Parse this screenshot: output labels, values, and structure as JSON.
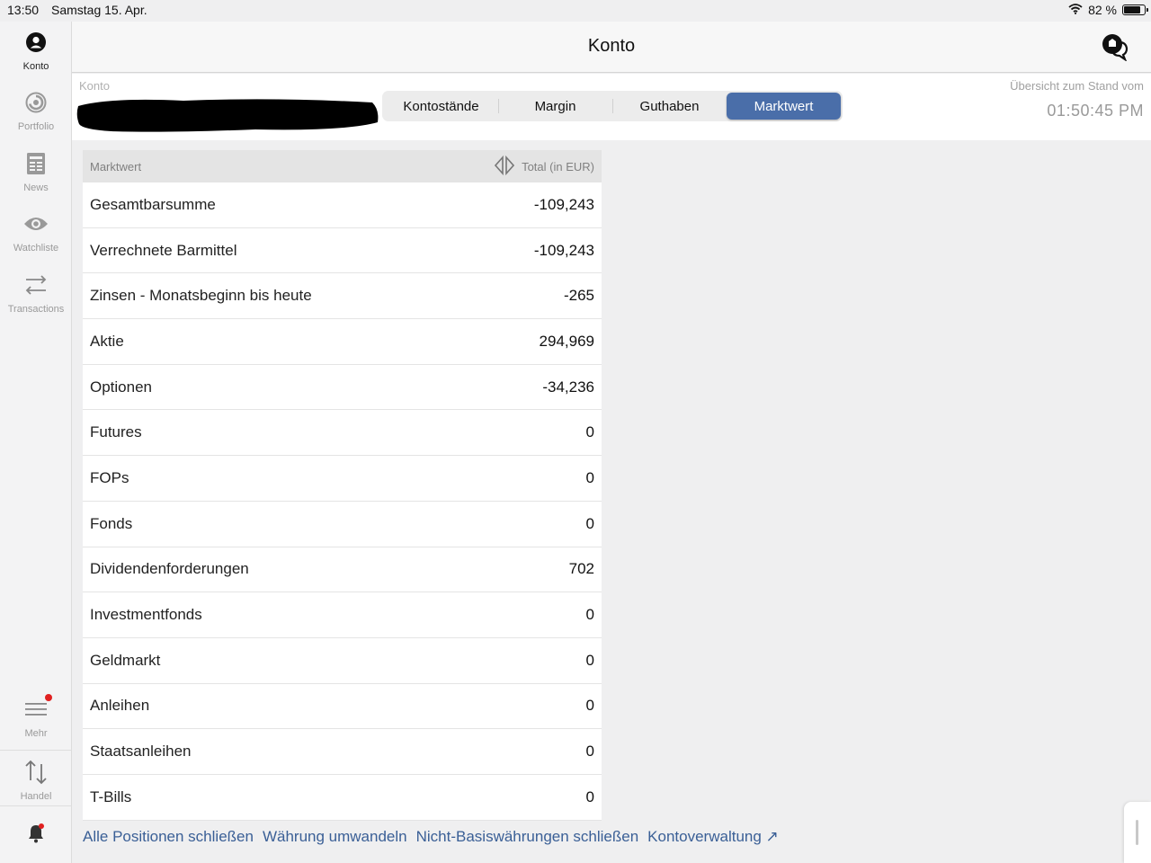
{
  "status_bar": {
    "time": "13:50",
    "date": "Samstag 15. Apr.",
    "battery": "82 %",
    "battery_level": 0.82
  },
  "sidebar": {
    "items": [
      {
        "label": "Konto",
        "icon": "account-icon",
        "active": true
      },
      {
        "label": "Portfolio",
        "icon": "portfolio-icon",
        "active": false
      },
      {
        "label": "News",
        "icon": "news-icon",
        "active": false
      },
      {
        "label": "Watchliste",
        "icon": "eye-icon",
        "active": false
      },
      {
        "label": "Transactions",
        "icon": "transactions-icon",
        "active": false
      }
    ],
    "more_label": "Mehr",
    "trade_label": "Handel"
  },
  "header": {
    "title": "Konto"
  },
  "account_bar": {
    "account_label": "Konto",
    "tabs": [
      {
        "label": "Kontostände",
        "active": false
      },
      {
        "label": "Margin",
        "active": false
      },
      {
        "label": "Guthaben",
        "active": false
      },
      {
        "label": "Marktwert",
        "active": true
      }
    ],
    "overview_label": "Übersicht zum Stand vom",
    "overview_time": "01:50:45 PM"
  },
  "table": {
    "header_left": "Marktwert",
    "header_right": "Total (in EUR)",
    "rows": [
      {
        "label": "Gesamtbarsumme",
        "value": "-109,243"
      },
      {
        "label": "Verrechnete Barmittel",
        "value": "-109,243"
      },
      {
        "label": "Zinsen - Monatsbeginn bis heute",
        "value": "-265"
      },
      {
        "label": "Aktie",
        "value": "294,969"
      },
      {
        "label": "Optionen",
        "value": "-34,236"
      },
      {
        "label": "Futures",
        "value": "0"
      },
      {
        "label": "FOPs",
        "value": "0"
      },
      {
        "label": "Fonds",
        "value": "0"
      },
      {
        "label": "Dividendenforderungen",
        "value": "702"
      },
      {
        "label": "Investmentfonds",
        "value": "0"
      },
      {
        "label": "Geldmarkt",
        "value": "0"
      },
      {
        "label": "Anleihen",
        "value": "0"
      },
      {
        "label": "Staatsanleihen",
        "value": "0"
      },
      {
        "label": "T-Bills",
        "value": "0"
      }
    ]
  },
  "footer_links": [
    "Alle Positionen schließen",
    "Währung umwandeln",
    "Nicht-Basiswährungen schließen",
    "Kontoverwaltung ↗"
  ],
  "colors": {
    "accent": "#4a6ea9",
    "link": "#3a5f96",
    "notification": "#e02020"
  }
}
